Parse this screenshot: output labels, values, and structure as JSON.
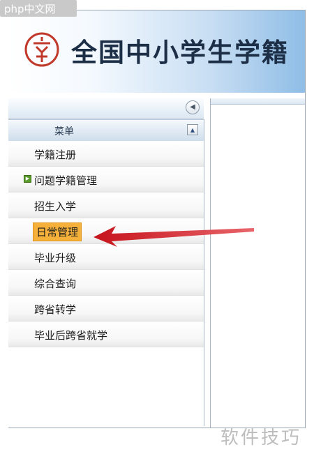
{
  "site_watermark": "php中文网",
  "header": {
    "title": "全国中小学生学籍"
  },
  "menu": {
    "title": "菜单",
    "items": [
      {
        "label": "学籍注册",
        "expandable": false,
        "active": false
      },
      {
        "label": "问题学籍管理",
        "expandable": true,
        "active": false
      },
      {
        "label": "招生入学",
        "expandable": false,
        "active": false
      },
      {
        "label": "日常管理",
        "expandable": false,
        "active": true
      },
      {
        "label": "毕业升级",
        "expandable": false,
        "active": false
      },
      {
        "label": "综合查询",
        "expandable": false,
        "active": false
      },
      {
        "label": "跨省转学",
        "expandable": false,
        "active": false
      },
      {
        "label": "毕业后跨省就学",
        "expandable": false,
        "active": false
      }
    ]
  },
  "footer_watermark": "软件技巧",
  "colors": {
    "highlight": "#f6b13a",
    "arrow": "#c6131b",
    "logo": "#c0392b",
    "expand_icon": "#5a9a2a"
  }
}
